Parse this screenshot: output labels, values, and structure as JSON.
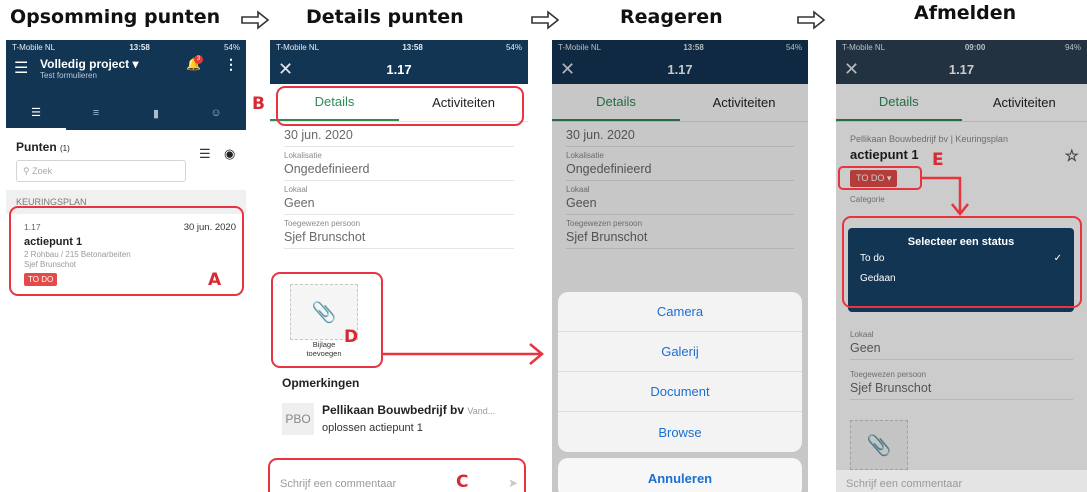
{
  "headings": {
    "screen1": "Opsomming punten",
    "screen2": "Details punten",
    "screen3": "Reageren",
    "screen4": "Afmelden"
  },
  "markers": {
    "a": "A",
    "b": "B",
    "c": "C",
    "d": "D",
    "e": "E"
  },
  "screen1": {
    "status": {
      "carrier": "T-Mobile NL",
      "time": "13:58",
      "battery": "54%"
    },
    "project_title": "Volledig project",
    "project_sub": "Test formulieren",
    "notif_count": "3",
    "section_title": "Punten",
    "section_count": "(1)",
    "search_placeholder": "Zoek",
    "band_label": "KEURINGSPLAN",
    "item": {
      "number": "1.17",
      "date": "30 jun. 2020",
      "name": "actiepunt 1",
      "path": "2 Rohbau / 215 Betonarbeiten",
      "person": "Sjef Brunschot",
      "status": "TO DO"
    }
  },
  "detail": {
    "title": "1.17",
    "tab_details": "Details",
    "tab_activities": "Activiteiten",
    "date": "30 jun. 2020",
    "localisation_label": "Lokalisatie",
    "localisation_value": "Ongedefinieerd",
    "room_label": "Lokaal",
    "room_value": "Geen",
    "assignee_label": "Toegewezen persoon",
    "assignee_value": "Sjef Brunschot"
  },
  "screen2": {
    "status": {
      "carrier": "T-Mobile NL",
      "time": "13:58",
      "battery": "54%"
    },
    "attach_label_1": "Bijlage",
    "attach_label_2": "toevoegen",
    "remarks_title": "Opmerkingen",
    "comment_initials": "PBO",
    "comment_author": "Pellikaan Bouwbedrijf bv",
    "comment_suffix": "Vand...",
    "comment_text": "oplossen actiepunt 1",
    "composer_placeholder": "Schrijf een commentaar"
  },
  "screen3": {
    "status": {
      "carrier": "T-Mobile NL",
      "time": "13:58",
      "battery": "54%"
    },
    "actions": [
      "Camera",
      "Galerij",
      "Document",
      "Browse"
    ],
    "cancel": "Annuleren"
  },
  "screen4": {
    "status": {
      "carrier": "T-Mobile NL",
      "time": "09:00",
      "battery": "94%"
    },
    "company": "Pellikaan Bouwbedrijf bv",
    "plan": "Keuringsplan",
    "point_name": "actiepunt 1",
    "status_value": "TO DO",
    "category_label": "Categorie",
    "popup_title": "Selecteer een status",
    "option_todo": "To do",
    "option_done": "Gedaan",
    "room_label": "Lokaal",
    "room_value": "Geen",
    "assignee_label": "Toegewezen persoon",
    "assignee_value": "Sjef Brunschot",
    "composer_placeholder": "Schrijf een commentaar"
  },
  "colors": {
    "navy": "#123554",
    "accent_green": "#2f8a57",
    "annotation_red": "#e8343f",
    "todo_red": "#e24b48",
    "link_blue": "#1a6fd1"
  }
}
